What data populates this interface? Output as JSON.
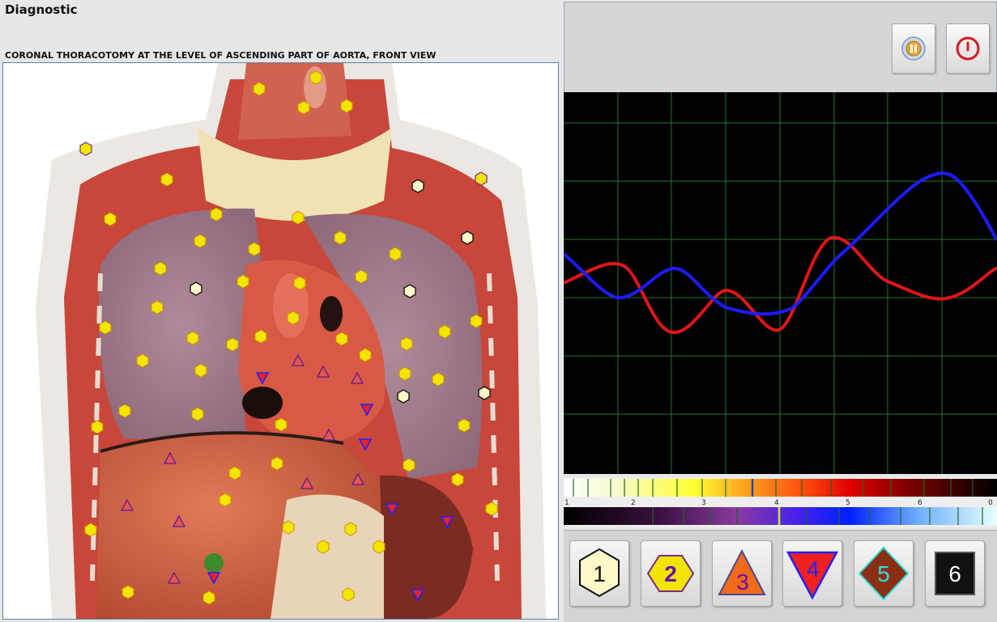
{
  "window": {
    "title": "Diagnostic"
  },
  "view": {
    "caption": "CORONAL THORACOTOMY AT THE LEVEL OF ASCENDING PART OF AORTA, FRONT VIEW"
  },
  "toolbar": {
    "buttons": [
      {
        "name": "sound-button",
        "icon": "speaker-icon"
      },
      {
        "name": "power-button",
        "icon": "power-icon",
        "color": "#d7191f"
      }
    ]
  },
  "graph": {
    "background": "#000000",
    "grid_color": "#1f7a2a",
    "series": [
      {
        "color": "#e01616"
      },
      {
        "color": "#1c1cff"
      }
    ]
  },
  "spectrum": {
    "scale_labels": [
      "1",
      "2",
      "3",
      "4",
      "5",
      "6",
      "0"
    ]
  },
  "levels": [
    {
      "label": "1",
      "shape": "hexagon",
      "fill": "#fff8c8",
      "text_color": "#111111"
    },
    {
      "label": "2",
      "shape": "hexagon",
      "fill": "#f2e500",
      "text_color": "#6a0dad"
    },
    {
      "label": "3",
      "shape": "triangle-up",
      "fill": "#f06a1a",
      "text_color": "#6a0dad"
    },
    {
      "label": "4",
      "shape": "triangle-down",
      "fill": "#f02020",
      "text_color": "#2020ff"
    },
    {
      "label": "5",
      "shape": "diamond",
      "fill": "#8b2f14",
      "text_color": "#2ce0e0"
    },
    {
      "label": "6",
      "shape": "square",
      "fill": "#111111",
      "text_color": "#ffffff"
    }
  ]
}
